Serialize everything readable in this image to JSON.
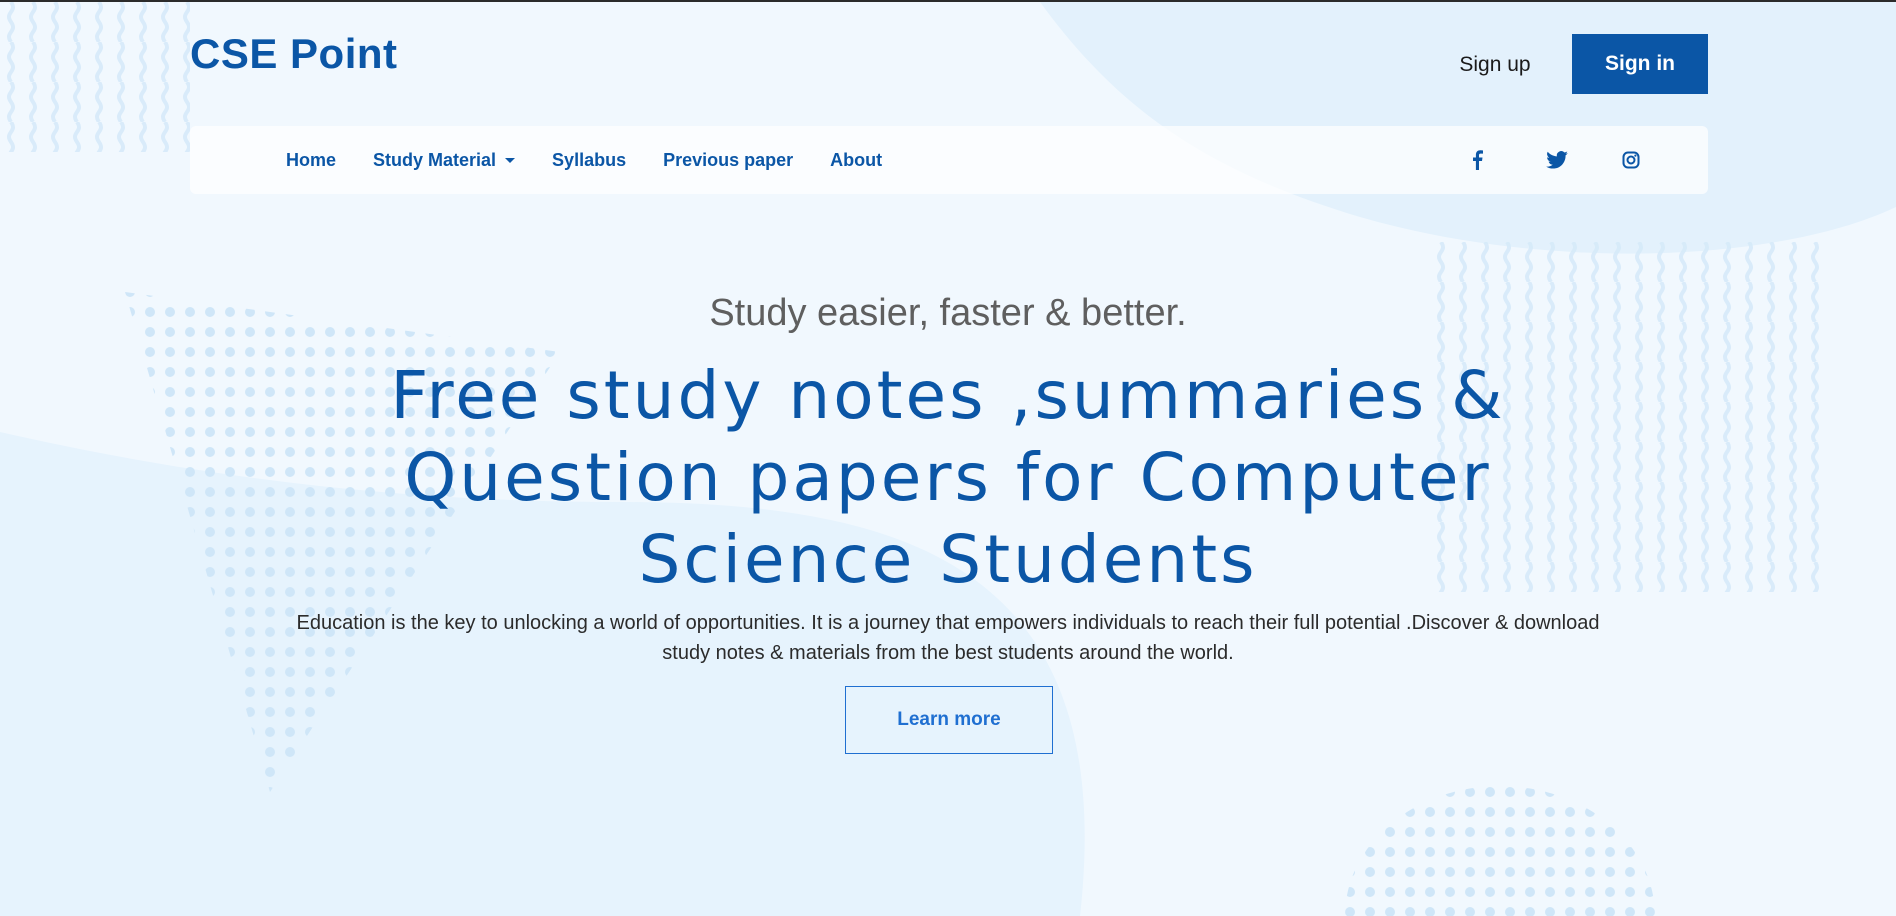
{
  "brand": {
    "name": "CSE Point"
  },
  "header": {
    "signup_label": "Sign up",
    "signin_label": "Sign in"
  },
  "nav": {
    "items": [
      {
        "label": "Home",
        "dropdown": false
      },
      {
        "label": "Study Material",
        "dropdown": true
      },
      {
        "label": "Syllabus",
        "dropdown": false
      },
      {
        "label": "Previous paper",
        "dropdown": false
      },
      {
        "label": "About",
        "dropdown": false
      }
    ],
    "social_icons": [
      "facebook-icon",
      "twitter-icon",
      "instagram-icon"
    ]
  },
  "hero": {
    "subtitle": "Study easier, faster & better.",
    "title_lines": [
      "Free study notes ,summaries &",
      "Question papers for Computer",
      "Science Students"
    ],
    "description": "Education is the key to unlocking a world of opportunities. It is a journey that empowers individuals to reach their full potential .Discover & download study notes & materials from the best students around the world.",
    "cta_label": "Learn more"
  },
  "colors": {
    "brand": "#0b56a6",
    "background": "#f1f8fe",
    "accent_shape": "#e3f1fc",
    "dots": "#cfe6f8",
    "cta_border": "#1f6fd1"
  }
}
